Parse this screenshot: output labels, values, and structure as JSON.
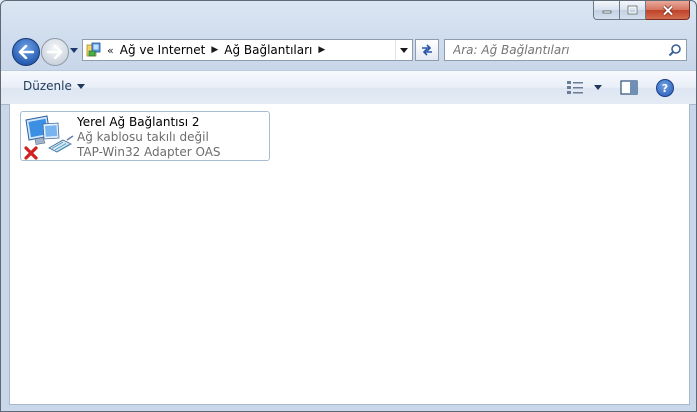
{
  "window": {
    "colors": {
      "frame": "#cfdced",
      "close": "#c0412a",
      "accent": "#2a5fb5"
    }
  },
  "address_bar": {
    "prefix": "«",
    "crumbs": [
      "Ağ ve Internet",
      "Ağ Bağlantıları"
    ],
    "icon": "network-folder-icon"
  },
  "search": {
    "placeholder": "Ara: Ağ Bağlantıları"
  },
  "toolbar": {
    "organize_label": "Düzenle"
  },
  "items": [
    {
      "name": "Yerel Ağ Bağlantısı 2",
      "status": "Ağ kablosu takılı değil",
      "device": "TAP-Win32 Adapter OAS",
      "icon": "network-adapter-disconnected-icon"
    }
  ]
}
